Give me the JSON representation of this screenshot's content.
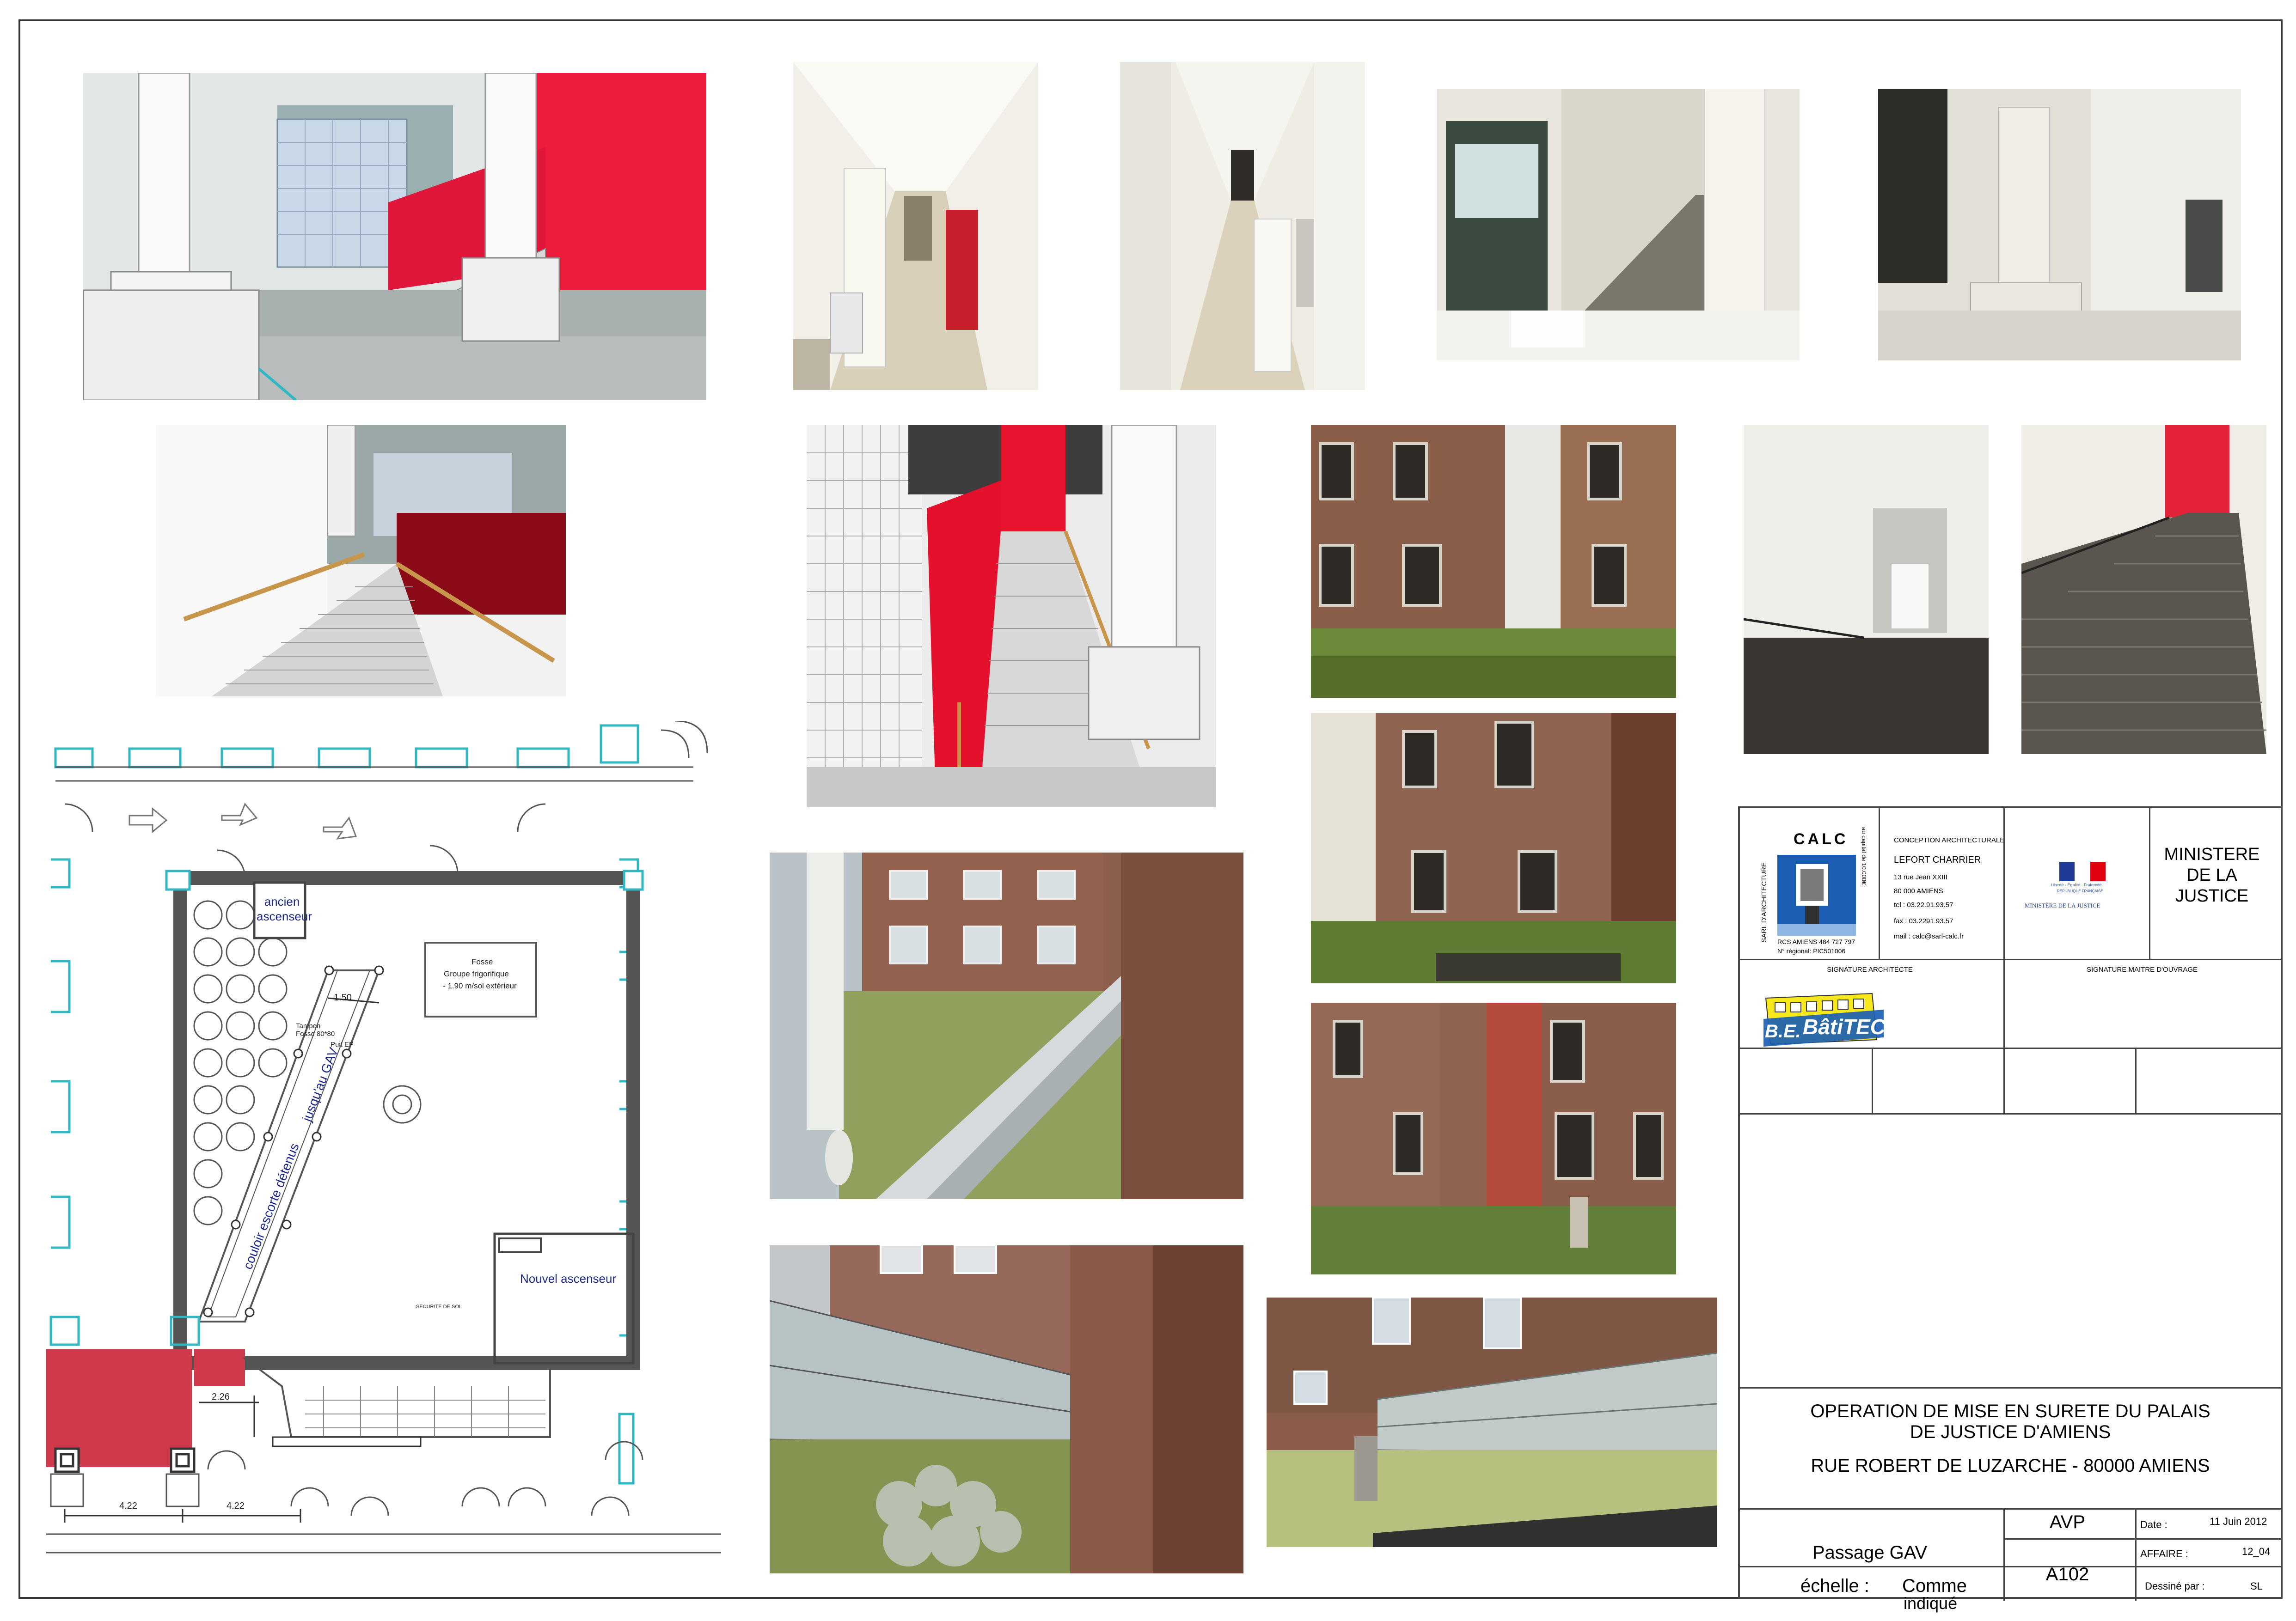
{
  "plan": {
    "label_ancien_ascenseur": "ancien ascenseur",
    "label_fosse_1": "Fosse",
    "label_fosse_2": "Groupe frigorifique",
    "label_fosse_3": "- 1.90 m/sol extérieur",
    "label_nouvel_ascenseur": "Nouvel ascenseur",
    "label_couloir": "couloir escorte détenus",
    "label_jusqu": "jusqu'au GAV",
    "label_dim_150": "1.50",
    "label_dim_226": "2.26",
    "label_dim_422_a": "4.22",
    "label_dim_422_b": "4.22",
    "label_tampon": "Tampon Fosse 80*80",
    "label_puit": "Puit EP",
    "label_sas": "SECURITE DE SOL"
  },
  "title_block": {
    "calc_name": "CALC",
    "calc_vertical": "SARL D'ARCHITECTURE",
    "calc_capital": "au capital de 10.000€",
    "calc_rcs": "RCS AMIENS 484 727 797",
    "calc_regional": "N° régional: PIC501006",
    "conception_heading": "CONCEPTION ARCHITECTURALE",
    "conception_name": "LEFORT CHARRIER",
    "conception_addr1": "13 rue Jean XXIII",
    "conception_addr2": "80 000 AMIENS",
    "conception_tel": "tel : 03.22.91.93.57",
    "conception_fax": "fax : 03.2291.93.57",
    "conception_mail": "mail : calc@sarl-calc.fr",
    "ministere_logo_text": "Liberté · Égalité · Fraternité",
    "ministere_logo_sub": "RÉPUBLIQUE FRANÇAISE",
    "ministere_logo_name": "MINISTÈRE DE LA JUSTICE",
    "ministere_title_1": "MINISTERE",
    "ministere_title_2": "DE LA",
    "ministere_title_3": "JUSTICE",
    "signature_architecte": "SIGNATURE ARCHITECTE",
    "signature_maitre": "SIGNATURE MAITRE D'OUVRAGE",
    "batitech_prefix": "B.E.",
    "batitech_name": "BâtiTECH",
    "operation_1": "OPERATION DE MISE EN SURETE DU PALAIS",
    "operation_2": "DE JUSTICE D'AMIENS",
    "address": "RUE ROBERT DE LUZARCHE - 80000 AMIENS",
    "phase": "AVP",
    "date_label": "Date :",
    "date_value": "11 Juin 2012",
    "drawing_title": "Passage GAV",
    "scale_label": "échelle :",
    "scale_value_1": "Comme",
    "scale_value_2": "indiqué",
    "sheet_number": "A102",
    "affaire_label": "AFFAIRE :",
    "affaire_value": "12_04",
    "dessine_label": "Dessiné par :",
    "dessine_value": "SL"
  },
  "colors": {
    "accent_red": "#e4002b",
    "dark_red": "#8b0a14",
    "plan_red": "#d0384b",
    "plan_cyan": "#2fb7c4",
    "plan_blue_text": "#1f2a8a",
    "brick": "#8e5c4a",
    "grass": "#6b8a3a"
  }
}
